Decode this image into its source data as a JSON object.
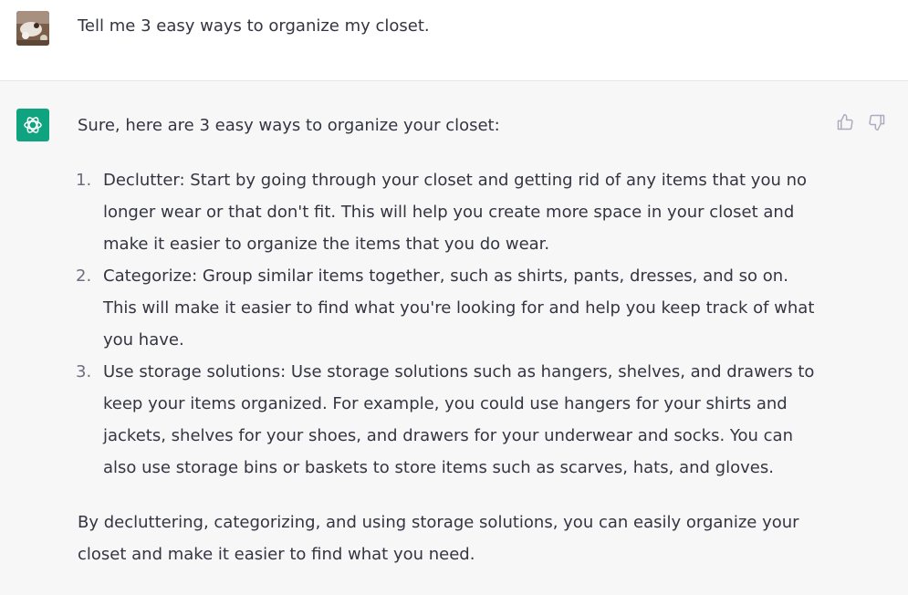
{
  "user": {
    "message": "Tell me 3 easy ways to organize my closet."
  },
  "assistant": {
    "intro": "Sure, here are 3 easy ways to organize your closet:",
    "items": [
      {
        "number": "1.",
        "text": "Declutter: Start by going through your closet and getting rid of any items that you no longer wear or that don't fit. This will help you create more space in your closet and make it easier to organize the items that you do wear."
      },
      {
        "number": "2.",
        "text": "Categorize: Group similar items together, such as shirts, pants, dresses, and so on. This will make it easier to find what you're looking for and help you keep track of what you have."
      },
      {
        "number": "3.",
        "text": "Use storage solutions: Use storage solutions such as hangers, shelves, and drawers to keep your items organized. For example, you could use hangers for your shirts and jackets, shelves for your shoes, and drawers for your underwear and socks. You can also use storage bins or baskets to store items such as scarves, hats, and gloves."
      }
    ],
    "conclusion": "By decluttering, categorizing, and using storage solutions, you can easily organize your closet and make it easier to find what you need."
  },
  "icons": {
    "user_avatar": "user-avatar-photo",
    "assistant_avatar": "openai-logo-icon",
    "feedback_up": "thumbs-up-icon",
    "feedback_down": "thumbs-down-icon"
  },
  "colors": {
    "assistant_bg": "#f7f7f8",
    "brand_green": "#10a37f",
    "text": "#343541"
  }
}
